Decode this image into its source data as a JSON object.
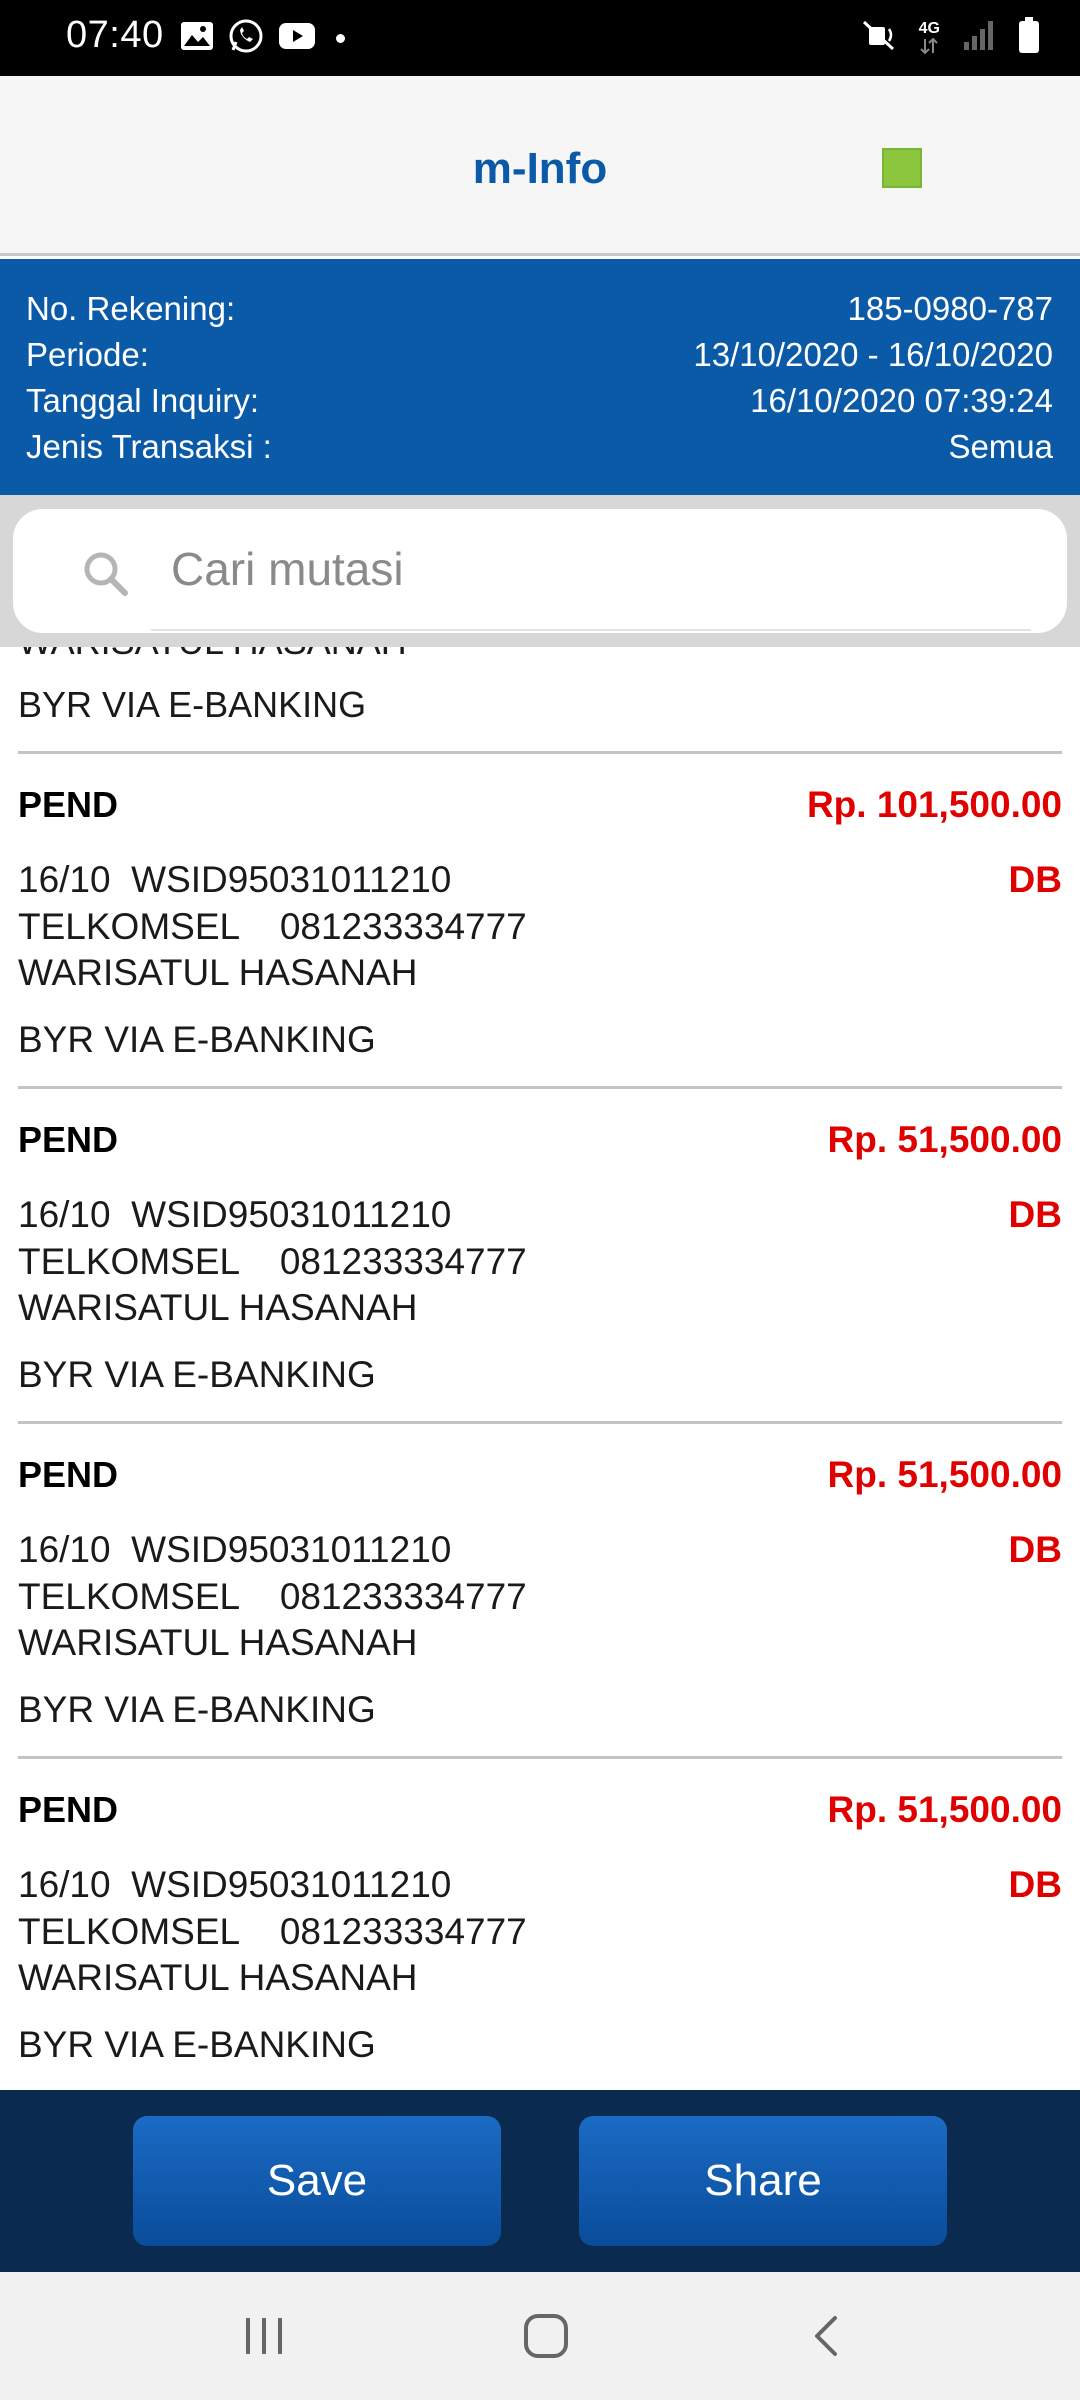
{
  "status_bar": {
    "time": "07:40",
    "left_icons": [
      "image-icon",
      "whatsapp-icon",
      "youtube-icon"
    ],
    "network": "4G"
  },
  "header": {
    "title": "m-Info",
    "indicator_color": "#8cc63f"
  },
  "account": {
    "rows": [
      {
        "label": "No. Rekening:",
        "value": "185-0980-787"
      },
      {
        "label": "Periode:",
        "value": "13/10/2020 - 16/10/2020"
      },
      {
        "label": "Tanggal Inquiry:",
        "value": "16/10/2020 07:39:24"
      },
      {
        "label": "Jenis Transaksi :",
        "value": "Semua"
      }
    ]
  },
  "search": {
    "placeholder": "Cari mutasi"
  },
  "partial_item": {
    "name_cut": "WARISATUL HASANAH",
    "note": "BYR VIA E-BANKING"
  },
  "transactions": [
    {
      "status": "PEND",
      "amount": "Rp. 101,500.00",
      "type": "DB",
      "line1": "16/10  WSID95031011210",
      "line2": "TELKOMSEL    081233334777",
      "line3": "WARISATUL HASANAH",
      "note": "BYR VIA E-BANKING"
    },
    {
      "status": "PEND",
      "amount": "Rp. 51,500.00",
      "type": "DB",
      "line1": "16/10  WSID95031011210",
      "line2": "TELKOMSEL    081233334777",
      "line3": "WARISATUL HASANAH",
      "note": "BYR VIA E-BANKING"
    },
    {
      "status": "PEND",
      "amount": "Rp. 51,500.00",
      "type": "DB",
      "line1": "16/10  WSID95031011210",
      "line2": "TELKOMSEL    081233334777",
      "line3": "WARISATUL HASANAH",
      "note": "BYR VIA E-BANKING"
    },
    {
      "status": "PEND",
      "amount": "Rp. 51,500.00",
      "type": "DB",
      "line1": "16/10  WSID95031011210",
      "line2": "TELKOMSEL    081233334777",
      "line3": "WARISATUL HASANAH",
      "note": "BYR VIA E-BANKING"
    }
  ],
  "actions": {
    "save_label": "Save",
    "share_label": "Share"
  },
  "colors": {
    "brand_blue": "#0b5aa8",
    "debit_red": "#e00000",
    "action_bar": "#0a2a4f"
  }
}
